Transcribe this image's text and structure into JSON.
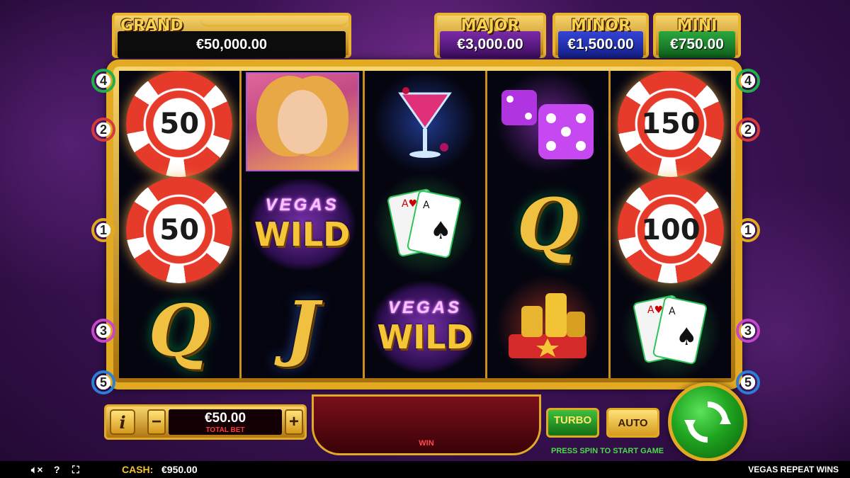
{
  "jackpots": {
    "grand": {
      "label": "GRAND",
      "value": "€50,000.00"
    },
    "major": {
      "label": "MAJOR",
      "value": "€3,000.00"
    },
    "minor": {
      "label": "MINOR",
      "value": "€1,500.00"
    },
    "mini": {
      "label": "MINI",
      "value": "€750.00"
    }
  },
  "paylines_left": [
    "4",
    "2",
    "1",
    "3",
    "5"
  ],
  "paylines_right": [
    "4",
    "2",
    "1",
    "3",
    "5"
  ],
  "reels": [
    [
      {
        "type": "chip",
        "value": "50"
      },
      {
        "type": "chip",
        "value": "50"
      },
      {
        "type": "letter",
        "value": "Q",
        "icon": "queen-icon"
      }
    ],
    [
      {
        "type": "portrait",
        "icon": "woman-portrait-icon"
      },
      {
        "type": "wild",
        "top": "VEGAS",
        "bottom": "WILD"
      },
      {
        "type": "letter",
        "value": "J",
        "icon": "jack-icon"
      }
    ],
    [
      {
        "type": "cocktail",
        "icon": "cocktail-glass-icon"
      },
      {
        "type": "cards",
        "icon": "playing-cards-icon"
      },
      {
        "type": "wild",
        "top": "VEGAS",
        "bottom": "WILD"
      }
    ],
    [
      {
        "type": "dice",
        "icon": "dice-icon"
      },
      {
        "type": "letter",
        "value": "Q",
        "icon": "queen-icon"
      },
      {
        "type": "coins",
        "icon": "coin-stack-icon"
      }
    ],
    [
      {
        "type": "chip",
        "value": "150"
      },
      {
        "type": "chip",
        "value": "100"
      },
      {
        "type": "cards",
        "icon": "playing-cards-icon"
      }
    ]
  ],
  "controls": {
    "info_label": "i",
    "minus_label": "−",
    "plus_label": "+",
    "bet_amount": "€50.00",
    "bet_label": "TOTAL BET",
    "win_label": "WIN",
    "turbo_label": "TURBO",
    "auto_label": "AUTO",
    "press_spin": "PRESS SPIN TO START GAME"
  },
  "status": {
    "cash_label": "CASH:",
    "cash_value": "€950.00",
    "game_name": "VEGAS REPEAT WINS",
    "sound_icon": "sound-muted-icon",
    "help_icon": "help-icon",
    "fullscreen_icon": "fullscreen-icon"
  },
  "colors": {
    "gold": "#e2a923",
    "major": "#5a1a86",
    "minor": "#1f2fb0",
    "mini": "#1a7a2a",
    "spin_green": "#1fa41f"
  }
}
